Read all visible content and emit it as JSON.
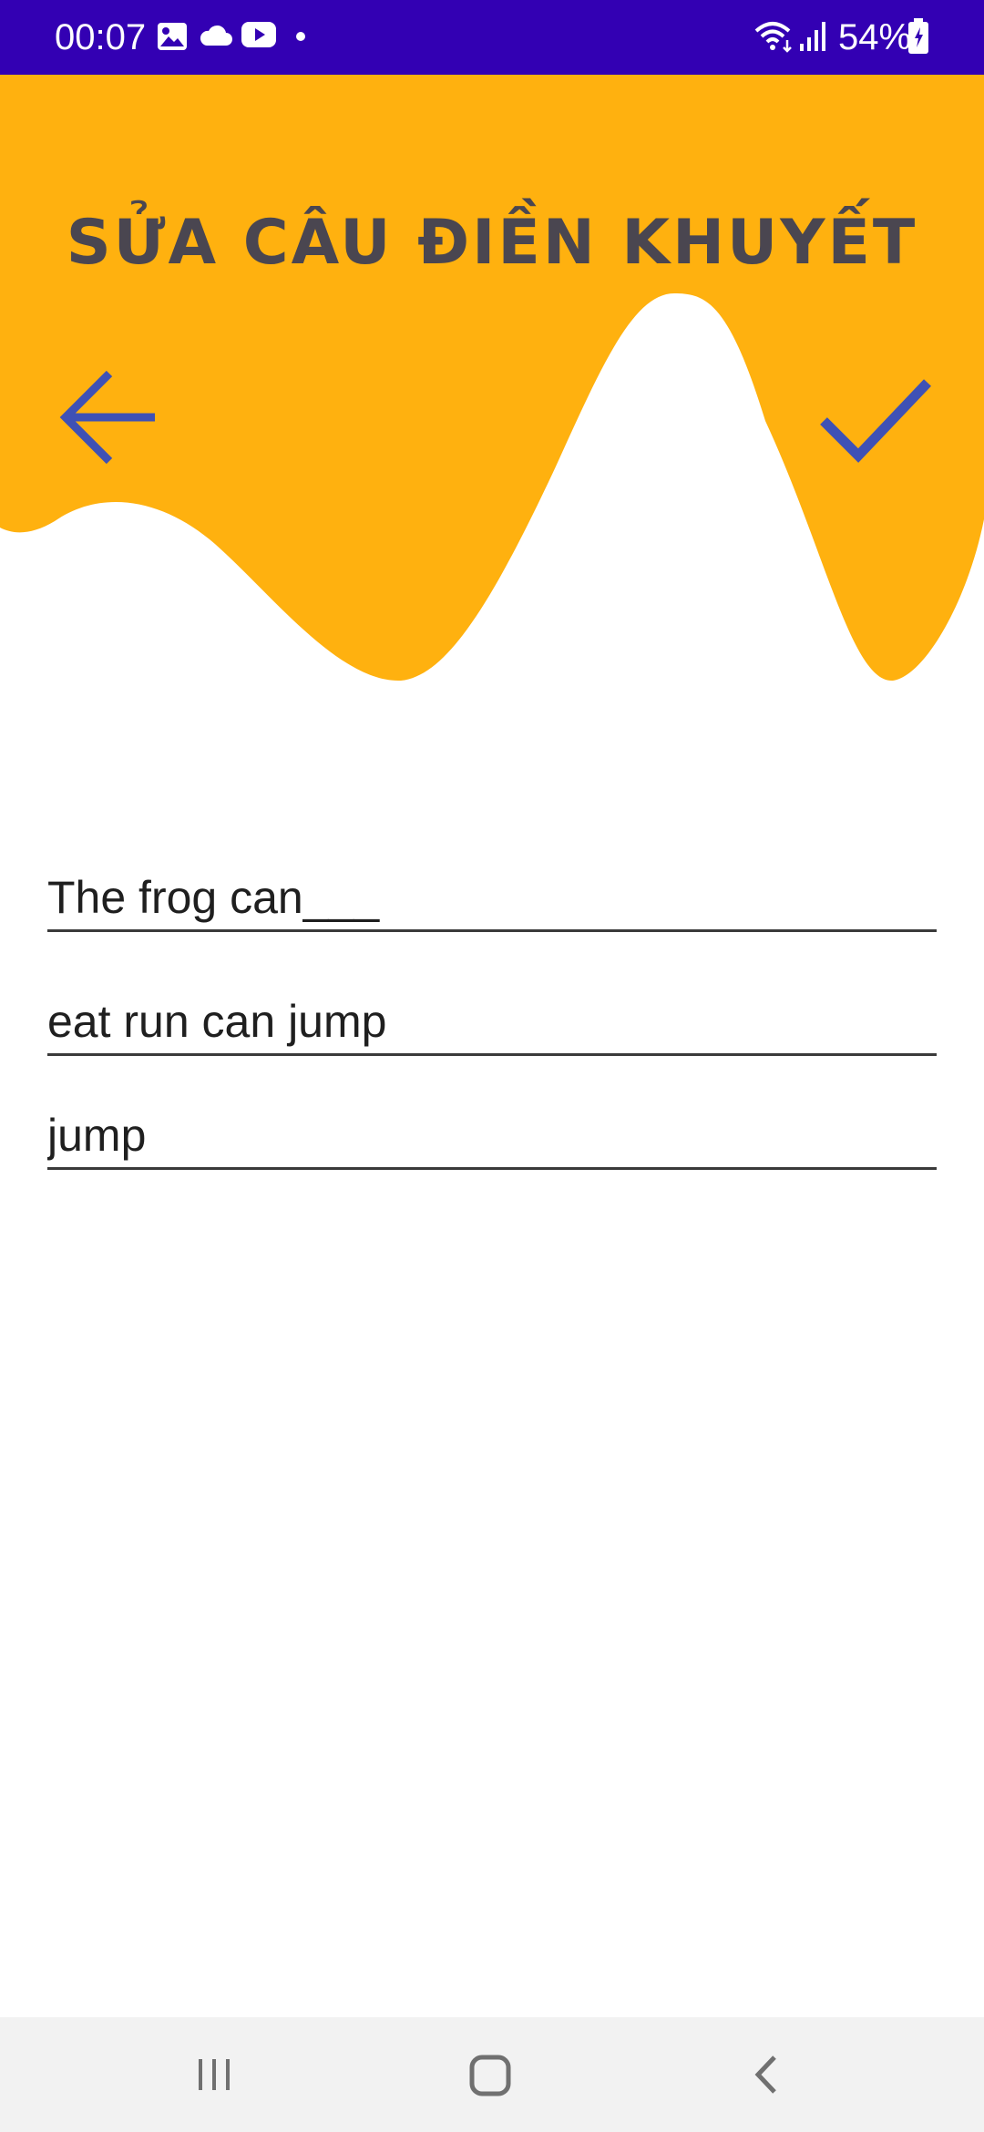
{
  "status_bar": {
    "time": "00:07",
    "battery": "54%",
    "icons": [
      "gallery-icon",
      "cloud-icon",
      "youtube-icon",
      "dot-icon",
      "wifi-icon",
      "signal-icon",
      "battery-icon"
    ],
    "background_color": "#3300b3"
  },
  "header": {
    "title": "SỬA CÂU ĐIỀN KHUYẾT",
    "back_icon": "arrow-left-icon",
    "confirm_icon": "check-icon",
    "accent_color": "#ffb10f",
    "icon_color": "#3f51b5"
  },
  "form": {
    "question": "The frog can___",
    "options": "eat run can jump",
    "answer": "jump"
  },
  "nav_bar": {
    "icons": [
      "recents-icon",
      "home-icon",
      "back-icon"
    ]
  }
}
